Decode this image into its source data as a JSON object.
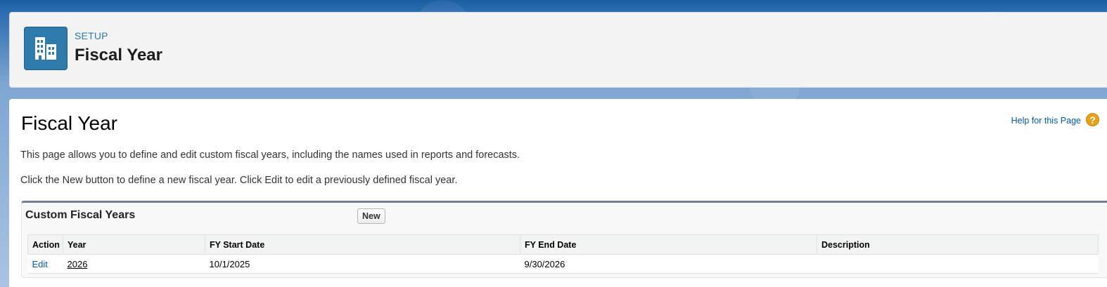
{
  "header": {
    "eyebrow": "SETUP",
    "title": "Fiscal Year",
    "icon": "building-icon",
    "accent_color": "#2e7bab"
  },
  "page": {
    "title": "Fiscal Year",
    "help_link": "Help for this Page",
    "help_icon": "?",
    "description_1": "This page allows you to define and edit custom fiscal years, including the names used in reports and forecasts.",
    "description_2": "Click the New button to define a new fiscal year. Click Edit to edit a previously defined fiscal year."
  },
  "custom_fiscal_years": {
    "title": "Custom Fiscal Years",
    "new_button": "New",
    "columns": [
      "Action",
      "Year",
      "FY Start Date",
      "FY End Date",
      "Description"
    ],
    "rows": [
      {
        "action": "Edit",
        "year": "2026",
        "fy_start_date": "10/1/2025",
        "fy_end_date": "9/30/2026",
        "description": ""
      }
    ]
  }
}
